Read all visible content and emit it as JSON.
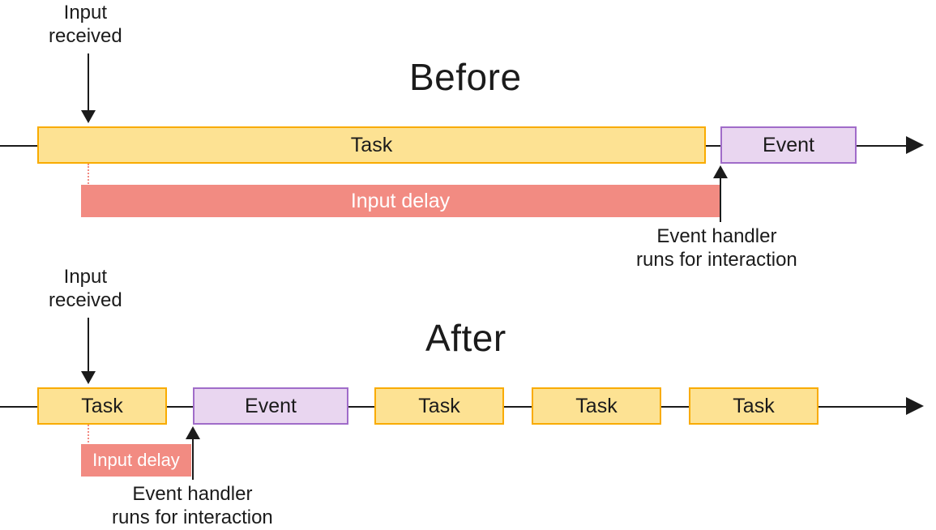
{
  "titles": {
    "before": "Before",
    "after": "After"
  },
  "labels": {
    "input_received": "Input\nreceived",
    "task": "Task",
    "event": "Event",
    "input_delay": "Input delay",
    "event_handler": "Event handler\nruns for interaction"
  },
  "colors": {
    "task_fill": "#fde293",
    "task_border": "#f9ab00",
    "event_fill": "#e9d6f0",
    "event_border": "#a06cc9",
    "delay_fill": "#f28b82",
    "text": "#1b1b1b"
  },
  "chart_data": {
    "type": "timeline-diagram",
    "scenarios": [
      {
        "name": "Before",
        "input_received_at": 1,
        "tracks": [
          {
            "kind": "task",
            "label": "Task",
            "start": 0,
            "width": 16
          },
          {
            "kind": "event",
            "label": "Event",
            "start": 16.4,
            "width": 3.2
          }
        ],
        "input_delay": {
          "start": 1,
          "end": 16.4
        },
        "event_handler_at": 16.4
      },
      {
        "name": "After",
        "input_received_at": 1,
        "tracks": [
          {
            "kind": "task",
            "label": "Task",
            "start": 0,
            "width": 3
          },
          {
            "kind": "event",
            "label": "Event",
            "start": 3.6,
            "width": 3.6
          },
          {
            "kind": "task",
            "label": "Task",
            "start": 7.8,
            "width": 3
          },
          {
            "kind": "task",
            "label": "Task",
            "start": 11.4,
            "width": 3
          },
          {
            "kind": "task",
            "label": "Task",
            "start": 15.0,
            "width": 3
          }
        ],
        "input_delay": {
          "start": 1,
          "end": 3.6
        },
        "event_handler_at": 3.6
      }
    ],
    "axis_range": [
      0,
      20
    ]
  }
}
